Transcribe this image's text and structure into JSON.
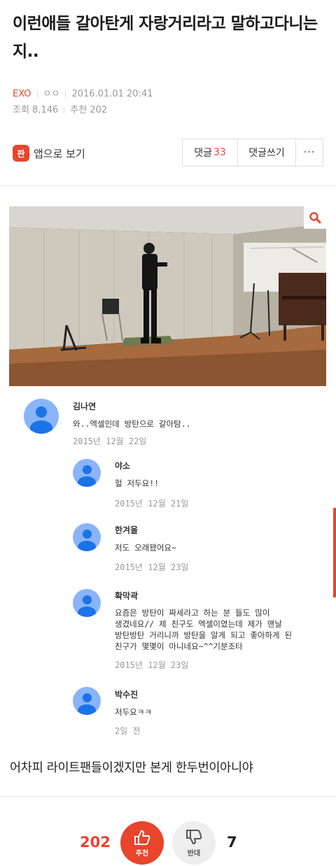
{
  "post": {
    "title": "이런애들 갈아탄게 자랑거리라고 말하고다니는지..",
    "category": "EXO",
    "author": "ㅇㅇ",
    "datetime": "2016.01.01 20:41",
    "views": "조회 8,146",
    "recommend": "추천 202",
    "body": "어차피 라이트팬들이겠지만 본게 한두번이아니야"
  },
  "toolbar": {
    "app_icon_text": "판",
    "app_label": "앱으로 보기",
    "comments_label": "댓글",
    "comments_count": "33",
    "write_label": "댓글쓰기",
    "more_label": "···"
  },
  "screenshot_comments": [
    {
      "name": "김나연",
      "text": [
        "와..엑셀인데 방탄으로 갈아탐.."
      ],
      "date": "2015년 12월 22일"
    },
    {
      "name": "야소",
      "text": [
        "헐 저두요!!"
      ],
      "date": "2015년 12월 21일"
    },
    {
      "name": "한겨울",
      "text": [
        "저도 오래됐어요~"
      ],
      "date": "2015년 12월 23일"
    },
    {
      "name": "확막곽",
      "text": [
        "요즘은 방탄이 짜세라고 하는 분 들도 많이",
        "생겼네요// 제 친구도 엑셀이였는데 제가 맨날",
        "방탄방탄 거리니까 방탄을 알게 되고 좋아하게 된",
        "친구가 몇몇이 아니네요~^^기분조타"
      ],
      "date": "2015년 12월 23일"
    },
    {
      "name": "박수진",
      "text": [
        "저두요ㅋㅋ"
      ],
      "date": "2일 전"
    }
  ],
  "votes": {
    "up_count": "202",
    "up_label": "추천",
    "down_count": "7",
    "down_label": "반대"
  },
  "colors": {
    "accent": "#e8452c",
    "avatar_bg": "#8ab4f8",
    "avatar_fg": "#1a73e8"
  }
}
